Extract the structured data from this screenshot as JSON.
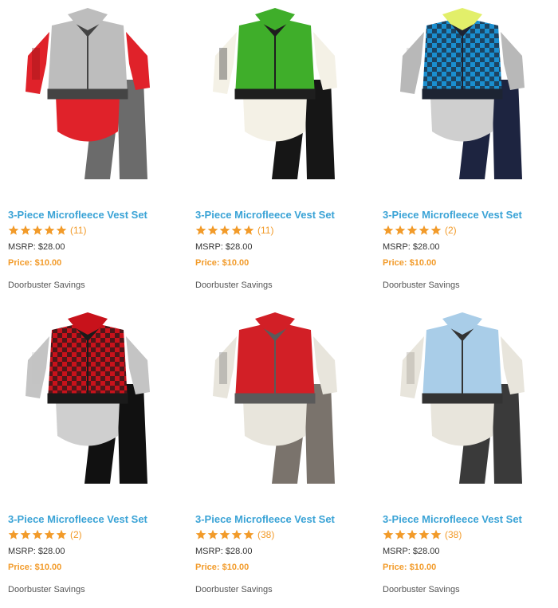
{
  "products": [
    {
      "title": "3-Piece Microfleece Vest Set",
      "rating": 5,
      "reviews": "(11)",
      "msrp": "MSRP: $28.00",
      "price": "Price: $10.00",
      "promo": "Doorbuster Savings",
      "colors": {
        "shirt": "#e0222a",
        "shirt_print": "#8a1015",
        "vest": "#bdbdbd",
        "vest_trim": "#444444",
        "bodysuit": "#e0222a",
        "pants": "#6b6b6b"
      }
    },
    {
      "title": "3-Piece Microfleece Vest Set",
      "rating": 5,
      "reviews": "(11)",
      "msrp": "MSRP: $28.00",
      "price": "Price: $10.00",
      "promo": "Doorbuster Savings",
      "colors": {
        "shirt": "#f4f1e6",
        "shirt_print": "#1e1e1e",
        "vest": "#3fae2a",
        "vest_trim": "#1e1e1e",
        "bodysuit": "#f4f1e6",
        "pants": "#161616"
      }
    },
    {
      "title": "3-Piece Microfleece Vest Set",
      "rating": 5,
      "reviews": "(2)",
      "msrp": "MSRP: $28.00",
      "price": "Price: $10.00",
      "promo": "Doorbuster Savings",
      "colors": {
        "shirt": "#b8b8b8",
        "shirt_print": "#b8b8b8",
        "vest": "#1a8fd0",
        "vest_trim": "#1d2433",
        "collar": "#e2ef6a",
        "bodysuit": "#cfcfcf",
        "pants": "#1d2440"
      }
    },
    {
      "title": "3-Piece Microfleece Vest Set",
      "rating": 5,
      "reviews": "(2)",
      "msrp": "MSRP: $28.00",
      "price": "Price: $10.00",
      "promo": "Doorbuster Savings",
      "colors": {
        "shirt": "#c4c4c4",
        "shirt_print": "#c4c4c4",
        "vest": "#c8121b",
        "vest_trim": "#1a1a1a",
        "bodysuit": "#cfcfcf",
        "pants": "#111111"
      }
    },
    {
      "title": "3-Piece Microfleece Vest Set",
      "rating": 5,
      "reviews": "(38)",
      "msrp": "MSRP: $28.00",
      "price": "Price: $10.00",
      "promo": "Doorbuster Savings",
      "colors": {
        "shirt": "#e8e5dc",
        "shirt_print": "#6c6c6c",
        "vest": "#d21f26",
        "vest_trim": "#5a5a5a",
        "bodysuit": "#e8e5dc",
        "pants": "#7a736c"
      }
    },
    {
      "title": "3-Piece Microfleece Vest Set",
      "rating": 5,
      "reviews": "(38)",
      "msrp": "MSRP: $28.00",
      "price": "Price: $10.00",
      "promo": "Doorbuster Savings",
      "colors": {
        "shirt": "#e8e5dc",
        "shirt_print": "#9a968c",
        "vest": "#a9cde8",
        "vest_trim": "#333333",
        "bodysuit": "#e8e5dc",
        "pants": "#3a3a3a"
      }
    }
  ],
  "theme": {
    "title_color": "#3aa3d6",
    "star_color": "#f29b2a",
    "price_color": "#f29b2a"
  }
}
